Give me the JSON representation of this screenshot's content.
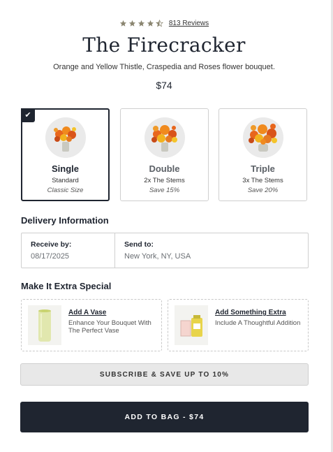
{
  "product": {
    "rating": 4.5,
    "reviews_label": "813 Reviews",
    "title": "The Firecracker",
    "description": "Orange and Yellow Thistle, Craspedia and Roses flower bouquet.",
    "price": "$74"
  },
  "size_options": [
    {
      "name": "Single",
      "desc": "Standard",
      "note": "Classic Size",
      "selected": true
    },
    {
      "name": "Double",
      "desc": "2x The Stems",
      "note": "Save 15%",
      "selected": false
    },
    {
      "name": "Triple",
      "desc": "3x The Stems",
      "note": "Save 20%",
      "selected": false
    }
  ],
  "delivery": {
    "section_title": "Delivery Information",
    "receive_label": "Receive by:",
    "receive_value": "08/17/2025",
    "send_label": "Send to:",
    "send_value": "New York, NY, USA"
  },
  "extras": {
    "section_title": "Make It Extra Special",
    "items": [
      {
        "title": "Add A Vase",
        "desc": "Enhance Your Bouquet With The Perfect Vase",
        "icon": "vase-image"
      },
      {
        "title": "Add Something Extra",
        "desc": "Include A Thoughtful Addition",
        "icon": "gift-image"
      }
    ]
  },
  "actions": {
    "subscribe_label": "SUBSCRIBE & SAVE UP TO 10%",
    "add_to_bag_label": "ADD TO BAG - $74"
  },
  "colors": {
    "primary": "#1f2530",
    "star": "#8a8570",
    "border": "#cfcfcf"
  }
}
